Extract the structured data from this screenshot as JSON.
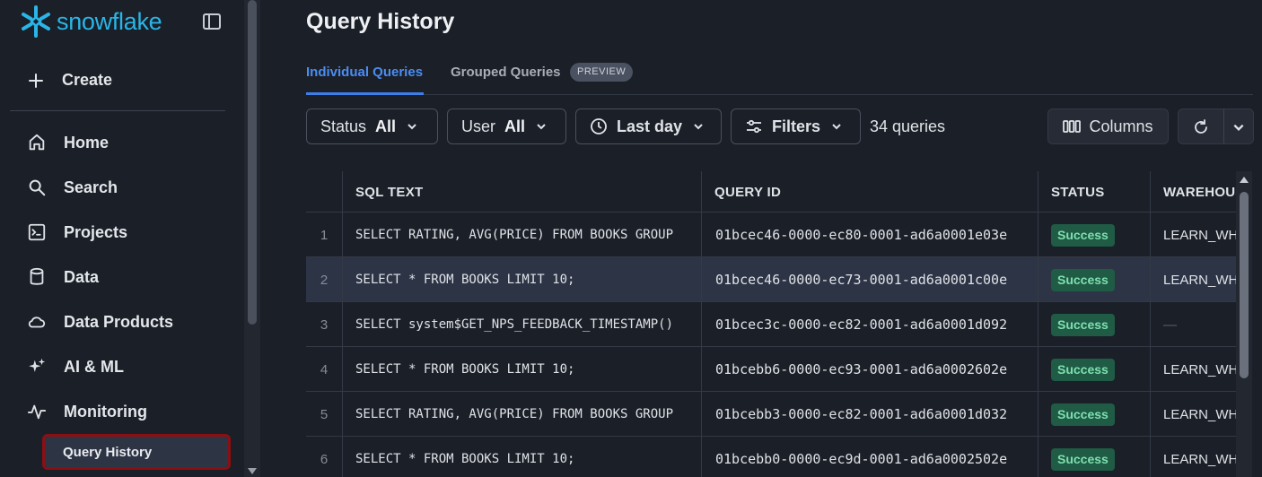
{
  "sidebar": {
    "brand": "snowflake",
    "create_label": "Create",
    "nav": [
      {
        "label": "Home",
        "icon": "home-icon"
      },
      {
        "label": "Search",
        "icon": "search-icon"
      },
      {
        "label": "Projects",
        "icon": "terminal-icon"
      },
      {
        "label": "Data",
        "icon": "database-icon"
      },
      {
        "label": "Data Products",
        "icon": "cloud-icon"
      },
      {
        "label": "AI & ML",
        "icon": "sparkle-icon"
      },
      {
        "label": "Monitoring",
        "icon": "pulse-icon"
      }
    ],
    "active_sub_item": "Query History"
  },
  "main": {
    "title": "Query History",
    "tabs": [
      {
        "label": "Individual Queries",
        "active": true
      },
      {
        "label": "Grouped Queries",
        "active": false,
        "badge": "PREVIEW"
      }
    ],
    "filters": {
      "status_label": "Status",
      "status_value": "All",
      "user_label": "User",
      "user_value": "All",
      "time_value": "Last day",
      "filters_label": "Filters",
      "count_text": "34 queries",
      "columns_label": "Columns"
    },
    "table": {
      "columns": [
        "SQL TEXT",
        "QUERY ID",
        "STATUS",
        "WAREHOUS"
      ],
      "rows": [
        {
          "num": "1",
          "sql": "SELECT RATING, AVG(PRICE) FROM BOOKS GROUP",
          "query_id": "01bcec46-0000-ec80-0001-ad6a0001e03e",
          "status": "Success",
          "warehouse": "LEARN_WH"
        },
        {
          "num": "2",
          "sql": "SELECT * FROM BOOKS LIMIT 10;",
          "query_id": "01bcec46-0000-ec73-0001-ad6a0001c00e",
          "status": "Success",
          "warehouse": "LEARN_WH"
        },
        {
          "num": "3",
          "sql": "SELECT system$GET_NPS_FEEDBACK_TIMESTAMP()",
          "query_id": "01bcec3c-0000-ec82-0001-ad6a0001d092",
          "status": "Success",
          "warehouse": "—"
        },
        {
          "num": "4",
          "sql": "SELECT * FROM BOOKS LIMIT 10;",
          "query_id": "01bcebb6-0000-ec93-0001-ad6a0002602e",
          "status": "Success",
          "warehouse": "LEARN_WH"
        },
        {
          "num": "5",
          "sql": "SELECT RATING, AVG(PRICE) FROM BOOKS GROUP",
          "query_id": "01bcebb3-0000-ec82-0001-ad6a0001d032",
          "status": "Success",
          "warehouse": "LEARN_WH"
        },
        {
          "num": "6",
          "sql": "SELECT * FROM BOOKS LIMIT 10;",
          "query_id": "01bcebb0-0000-ec9d-0001-ad6a0002502e",
          "status": "Success",
          "warehouse": "LEARN_WH"
        }
      ]
    }
  },
  "colors": {
    "accent": "#3d7fe8",
    "brand": "#29b5e8",
    "success_bg": "#1f5b45",
    "success_text": "#7fe0b0",
    "selection_outline": "#8c0f14"
  }
}
